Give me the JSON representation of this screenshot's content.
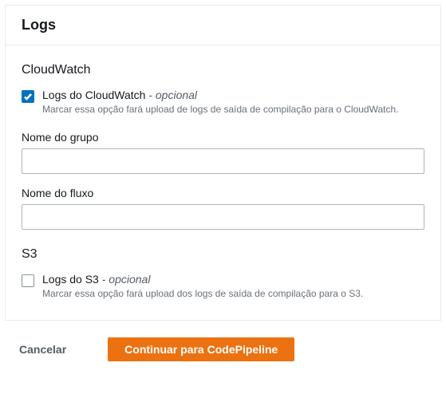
{
  "panel": {
    "title": "Logs"
  },
  "cloudwatch": {
    "section_title": "CloudWatch",
    "checkbox_label": "Logs do CloudWatch",
    "optional_suffix": " - opcional",
    "checkbox_desc": "Marcar essa opção fará upload de logs de saída de compilação para o CloudWatch.",
    "checked": true,
    "group_name_label": "Nome do grupo",
    "group_name_value": "",
    "stream_name_label": "Nome do fluxo",
    "stream_name_value": ""
  },
  "s3": {
    "section_title": "S3",
    "checkbox_label": "Logs do S3",
    "optional_suffix": " - opcional",
    "checkbox_desc": "Marcar essa opção fará upload dos logs de saída de compilação para o S3.",
    "checked": false
  },
  "footer": {
    "cancel_label": "Cancelar",
    "continue_label": "Continuar para CodePipeline"
  }
}
